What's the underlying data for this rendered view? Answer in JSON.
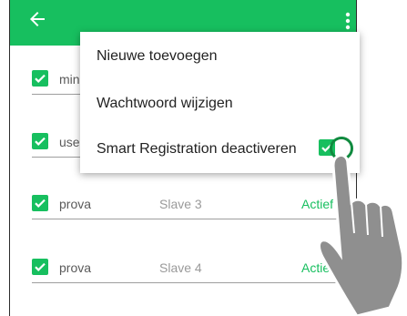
{
  "menu": {
    "items": [
      {
        "label": "Nieuwe toevoegen"
      },
      {
        "label": "Wachtwoord wijzigen"
      },
      {
        "label": "Smart Registration deactiveren"
      }
    ]
  },
  "list": {
    "rows": [
      {
        "name": "min",
        "slave": "",
        "status": ""
      },
      {
        "name": "use",
        "slave": "",
        "status": ""
      },
      {
        "name": "prova",
        "slave": "Slave 3",
        "status": "Actief"
      },
      {
        "name": "prova",
        "slave": "Slave 4",
        "status": "Actie"
      }
    ]
  },
  "colors": {
    "accent": "#17bf5f",
    "ring": "#108a3f"
  },
  "icons": {
    "back": "arrow-left-icon",
    "more": "more-vertical-icon",
    "checkbox": "checkbox-checked-icon",
    "hand": "pointing-hand-icon"
  }
}
